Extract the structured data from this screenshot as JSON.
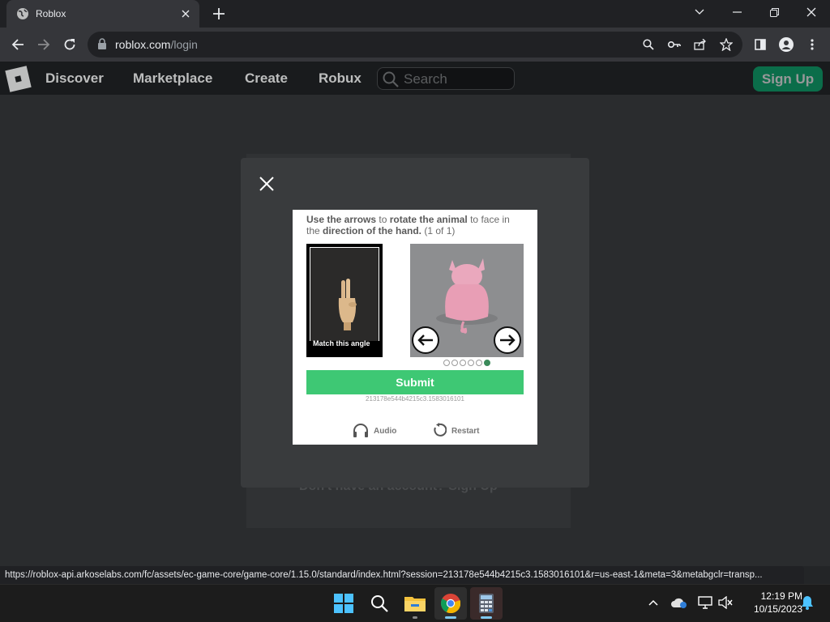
{
  "browser": {
    "tab_title": "Roblox",
    "url_domain": "roblox.com",
    "url_path": "/login",
    "status_url": "https://roblox-api.arkoselabs.com/fc/assets/ec-game-core/game-core/1.15.0/standard/index.html?session=213178e544b4215c3.1583016101&r=us-east-1&meta=3&metabgclr=transp..."
  },
  "roblox": {
    "nav": [
      "Discover",
      "Marketplace",
      "Create",
      "Robux"
    ],
    "search_placeholder": "Search",
    "signup_label": "Sign Up",
    "dont_have_account": "Don't have an account? Sign Up"
  },
  "captcha": {
    "instr_1": "Use the arrows",
    "instr_2": " to ",
    "instr_3": "rotate the animal",
    "instr_4": " to face in the ",
    "instr_5": "direction of the hand.",
    "instr_6": " (1 of 1)",
    "ref_caption": "Match this angle",
    "submit_label": "Submit",
    "session_id": "213178e544b4215c3.1583016101",
    "audio_label": "Audio",
    "restart_label": "Restart",
    "dots_total": 6,
    "dots_active": 6
  },
  "taskbar": {
    "time": "12:19 PM",
    "date": "10/15/2023"
  },
  "colors": {
    "roblox_bg": "#232527",
    "signup_green": "#00b06f",
    "submit_green": "#3ec874",
    "modal_bg": "#393b3d"
  },
  "icons": [
    "globe-icon",
    "close-icon",
    "plus-icon",
    "chevron-down-icon",
    "minimize-icon",
    "restore-icon",
    "back-icon",
    "forward-icon",
    "reload-icon",
    "lock-icon",
    "zoom-icon",
    "key-icon",
    "share-icon",
    "star-icon",
    "sidepanel-icon",
    "profile-icon",
    "menu-icon",
    "search-icon",
    "left-arrow-icon",
    "right-arrow-icon",
    "headphones-icon",
    "restart-icon",
    "windows-start-icon",
    "file-explorer-icon",
    "chrome-icon",
    "calculator-icon",
    "chevron-up-icon",
    "onedrive-icon",
    "display-icon",
    "volume-muted-icon",
    "bell-icon"
  ]
}
